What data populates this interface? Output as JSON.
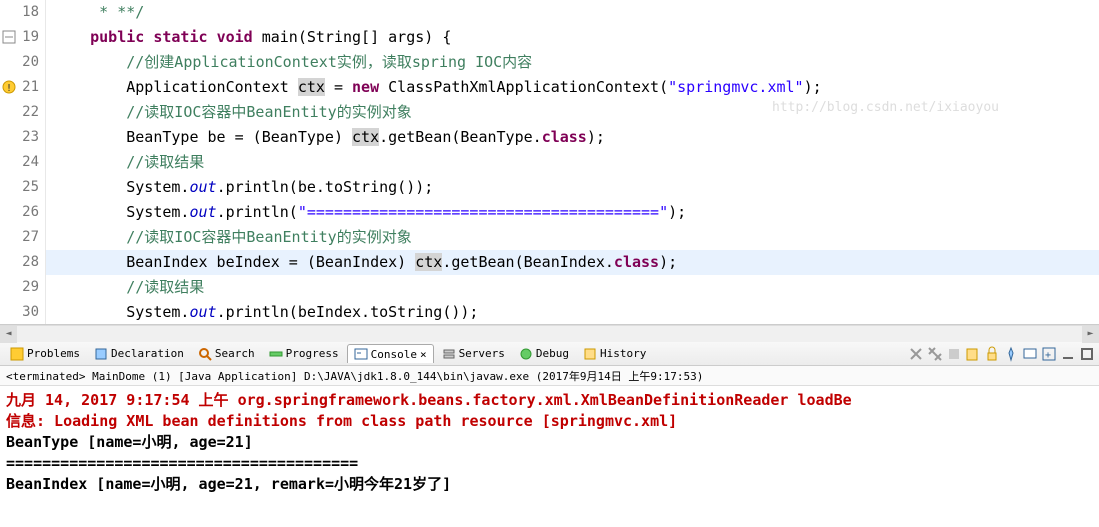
{
  "lines": [
    {
      "n": 18,
      "marker": null
    },
    {
      "n": 19,
      "marker": "fold"
    },
    {
      "n": 20,
      "marker": null
    },
    {
      "n": 21,
      "marker": "warn"
    },
    {
      "n": 22,
      "marker": null
    },
    {
      "n": 23,
      "marker": null
    },
    {
      "n": 24,
      "marker": null
    },
    {
      "n": 25,
      "marker": null
    },
    {
      "n": 26,
      "marker": null
    },
    {
      "n": 27,
      "marker": null
    },
    {
      "n": 28,
      "marker": null,
      "hl": true
    },
    {
      "n": 29,
      "marker": null
    },
    {
      "n": 30,
      "marker": null
    }
  ],
  "code": {
    "l18": "     * **/",
    "l19_kw1": "public",
    "l19_kw2": "static",
    "l19_kw3": "void",
    "l19_rest": " main(String[] args) {",
    "l20_cm": "//创建ApplicationContext实例，读取spring IOC内容",
    "l21_a": "ApplicationContext ",
    "l21_ctx": "ctx",
    "l21_b": " = ",
    "l21_new": "new",
    "l21_c": " ClassPathXmlApplicationContext(",
    "l21_s": "\"springmvc.xml\"",
    "l21_d": ");",
    "l22_cm": "//读取IOC容器中BeanEntity的实例对象",
    "l23_a": "BeanType be = (BeanType) ",
    "l23_ctx": "ctx",
    "l23_b": ".getBean(BeanType.",
    "l23_cls": "class",
    "l23_c": ");",
    "l24_cm": "//读取结果",
    "l25_a": "System.",
    "l25_out": "out",
    "l25_b": ".println(be.toString());",
    "l26_a": "System.",
    "l26_out": "out",
    "l26_b": ".println(",
    "l26_s": "\"=======================================\"",
    "l26_c": ");",
    "l27_cm": "//读取IOC容器中BeanEntity的实例对象",
    "l28_a": "BeanIndex beIndex = (BeanIndex) ",
    "l28_c1": "c",
    "l28_c2": "tx",
    "l28_b": ".getBean(BeanIndex.",
    "l28_cls": "class",
    "l28_c": ");",
    "l29_cm": "//读取结果",
    "l30_a": "System.",
    "l30_out": "out",
    "l30_b": ".println(beIndex.toString());"
  },
  "tabs": {
    "problems": "Problems",
    "declaration": "Declaration",
    "search": "Search",
    "progress": "Progress",
    "console": "Console",
    "servers": "Servers",
    "debug": "Debug",
    "history": "History",
    "close": "×"
  },
  "termHeader": "<terminated> MainDome (1) [Java Application] D:\\JAVA\\jdk1.8.0_144\\bin\\javaw.exe (2017年9月14日 上午9:17:53)",
  "consoleOut": {
    "l1": "九月 14, 2017 9:17:54 上午 org.springframework.beans.factory.xml.XmlBeanDefinitionReader loadBe",
    "l2": "信息: Loading XML bean definitions from class path resource [springmvc.xml]",
    "l3": "BeanType [name=小明, age=21]",
    "l4": "=======================================",
    "l5": "BeanIndex [name=小明, age=21, remark=小明今年21岁了]"
  },
  "watermark": "http://blog.csdn.net/ixiaoyou",
  "chart_data": null
}
